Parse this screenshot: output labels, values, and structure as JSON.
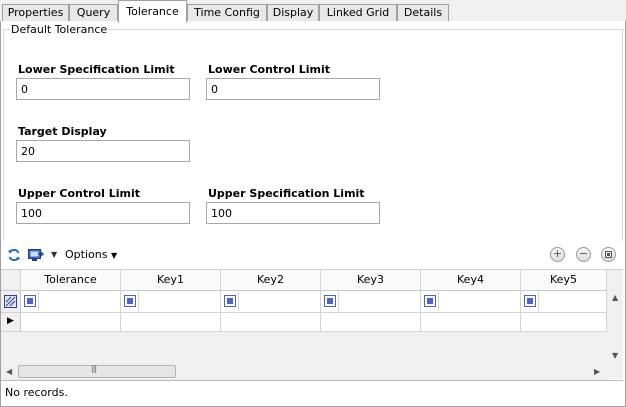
{
  "tabs": [
    "Properties",
    "Query",
    "Tolerance",
    "Time Config",
    "Display",
    "Linked Grid",
    "Details"
  ],
  "active_tab": "Tolerance",
  "group": {
    "title": "Default Tolerance"
  },
  "fields": {
    "lsl": {
      "label": "Lower Specification Limit",
      "value": "0"
    },
    "lcl": {
      "label": "Lower Control Limit",
      "value": "0"
    },
    "target": {
      "label": "Target Display",
      "value": "20"
    },
    "ucl": {
      "label": "Upper Control Limit",
      "value": "100"
    },
    "usl": {
      "label": "Upper Specification Limit",
      "value": "100"
    }
  },
  "toolbar": {
    "refresh_icon": "refresh-icon",
    "export_icon": "export-icon",
    "options_label": "Options",
    "add_icon": "plus-circle-icon",
    "remove_icon": "minus-circle-icon",
    "clear_icon": "clear-filter-icon"
  },
  "grid": {
    "columns": [
      "Tolerance",
      "Key1",
      "Key2",
      "Key3",
      "Key4",
      "Key5"
    ],
    "filter_row_icon": "filter-row-icon",
    "new_row_icon": "current-row-indicator-icon"
  },
  "status": {
    "text": "No records."
  },
  "colors": {
    "filter_checkbox": "#4b62c8",
    "tab_border": "#a0a0a0",
    "refresh_blue": "#1f6fd1"
  }
}
